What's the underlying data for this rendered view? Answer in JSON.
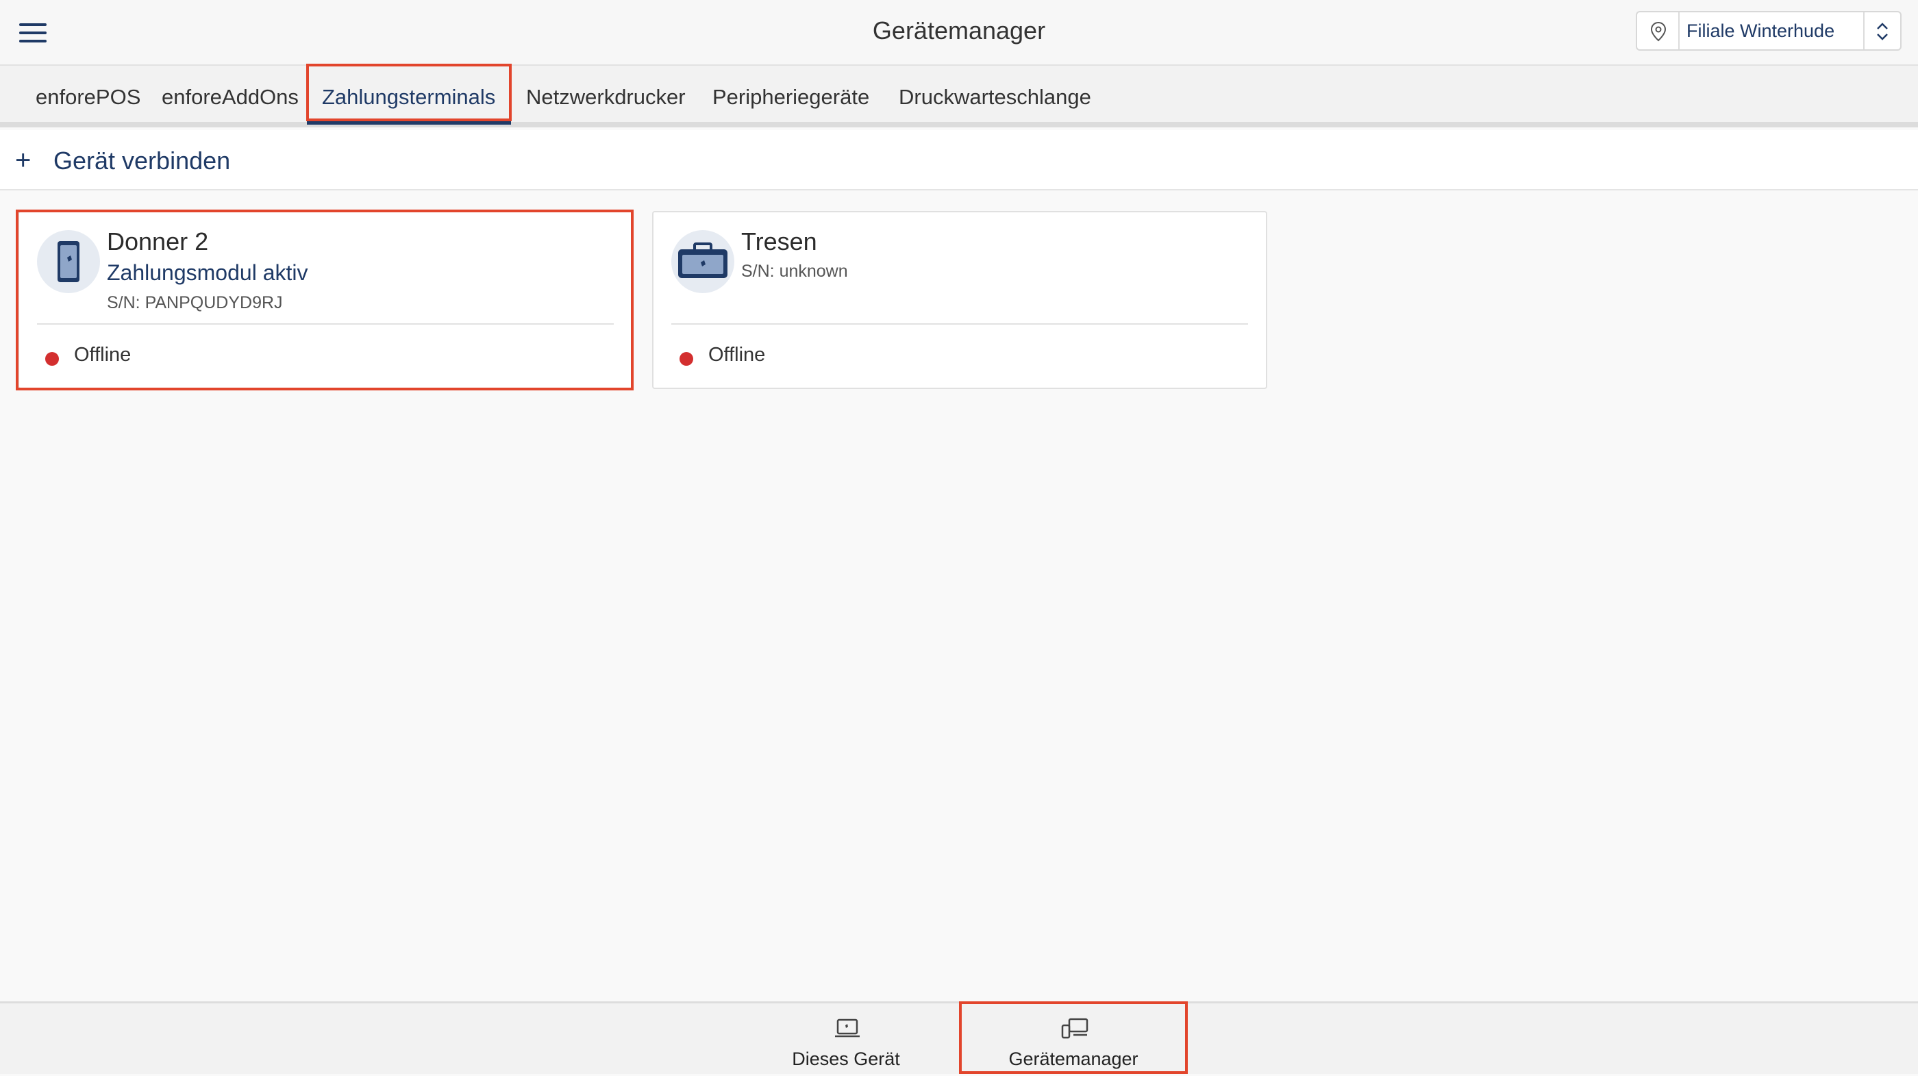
{
  "header": {
    "title": "Gerätemanager",
    "store": "Filiale Winterhude",
    "menu_icon": "hamburger-menu-icon",
    "location_icon": "location-pin-icon",
    "select_icon": "chevron-up-down-icon"
  },
  "tabs": [
    {
      "label": "enforePOS",
      "active": false
    },
    {
      "label": "enforeAddOns",
      "active": false
    },
    {
      "label": "Zahlungsterminals",
      "active": true
    },
    {
      "label": "Netzwerkdrucker",
      "active": false
    },
    {
      "label": "Peripheriegeräte",
      "active": false
    },
    {
      "label": "Druckwarteschlange",
      "active": false
    }
  ],
  "actions": {
    "connect_label": "Gerät verbinden",
    "connect_icon": "plus-icon"
  },
  "devices": [
    {
      "name": "Donner 2",
      "status_line": "Zahlungsmodul aktiv",
      "serial": "S/N: PANPQUDYD9RJ",
      "connection": "Offline",
      "icon": "handheld-terminal-icon"
    },
    {
      "name": "Tresen",
      "serial": "S/N: unknown",
      "connection": "Offline",
      "icon": "counter-terminal-icon"
    }
  ],
  "bottom_nav": [
    {
      "label": "Dieses Gerät",
      "icon": "this-device-icon",
      "active": false
    },
    {
      "label": "Gerätemanager",
      "icon": "device-manager-icon",
      "active": true
    }
  ],
  "colors": {
    "primary": "#1f3a66",
    "highlight": "#e2452c",
    "offline": "#d32f2f",
    "background": "#f9f9f9"
  }
}
